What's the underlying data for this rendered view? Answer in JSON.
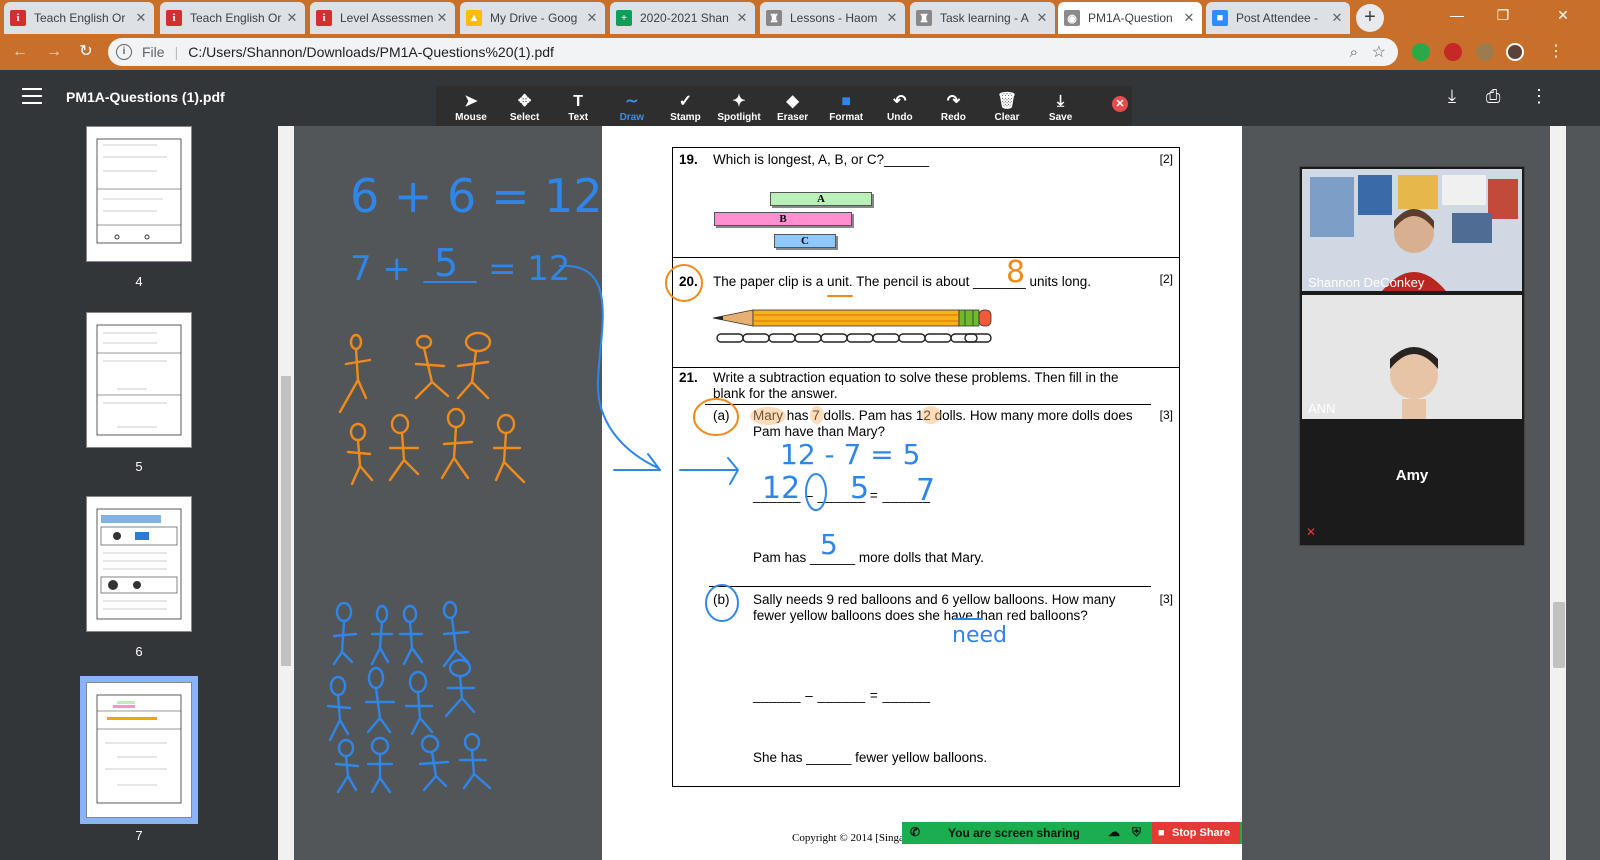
{
  "tabs": [
    {
      "title": "Teach English Or",
      "icon": "i",
      "color": "#d32f2f",
      "active": false
    },
    {
      "title": "Teach English Or",
      "icon": "i",
      "color": "#d32f2f",
      "active": false
    },
    {
      "title": "Level Assessmen",
      "icon": "i",
      "color": "#d32f2f",
      "active": false
    },
    {
      "title": "My Drive - Goog",
      "icon": "▲",
      "color": "#fbbc04",
      "active": false
    },
    {
      "title": "2020-2021 Shan",
      "icon": "+",
      "color": "#0f9d58",
      "active": false
    },
    {
      "title": "Lessons - Haom",
      "icon": "♜",
      "color": "#888888",
      "active": false
    },
    {
      "title": "Task learning - A",
      "icon": "♜",
      "color": "#888888",
      "active": false
    },
    {
      "title": "PM1A-Question",
      "icon": "◉",
      "color": "#8a8a8a",
      "active": true
    },
    {
      "title": "Post Attendee -",
      "icon": "■",
      "color": "#2d8cff",
      "active": false
    }
  ],
  "address": {
    "file_label": "File",
    "url": "C:/Users/Shannon/Downloads/PM1A-Questions%20(1).pdf"
  },
  "pdf": {
    "title": "PM1A-Questions (1).pdf"
  },
  "annotation_tools": [
    {
      "label": "Mouse",
      "icon": "➤"
    },
    {
      "label": "Select",
      "icon": "✥"
    },
    {
      "label": "Text",
      "icon": "T"
    },
    {
      "label": "Draw",
      "icon": "∼",
      "active": true
    },
    {
      "label": "Stamp",
      "icon": "✓"
    },
    {
      "label": "Spotlight",
      "icon": "✦"
    },
    {
      "label": "Eraser",
      "icon": "◆"
    },
    {
      "label": "Format",
      "icon": "■"
    },
    {
      "label": "Undo",
      "icon": "↶"
    },
    {
      "label": "Redo",
      "icon": "↷"
    },
    {
      "label": "Clear",
      "icon": "🗑"
    },
    {
      "label": "Save",
      "icon": "⤓"
    }
  ],
  "thumbnails": [
    {
      "num": "4"
    },
    {
      "num": "5"
    },
    {
      "num": "6"
    },
    {
      "num": "7"
    }
  ],
  "questions": {
    "q19": {
      "num": "19.",
      "text": "Which is longest, A, B, or C?______",
      "points": "[2]",
      "bars": [
        {
          "label": "A",
          "color": "#b8f0b8"
        },
        {
          "label": "B",
          "color": "#ff8fd0"
        },
        {
          "label": "C",
          "color": "#8fc8ff"
        }
      ]
    },
    "q20": {
      "num": "20.",
      "text_before": "The paper clip is a unit. The pencil is about ",
      "blank": "_______",
      "text_after": " units long.",
      "points": "[2]"
    },
    "q21": {
      "num": "21.",
      "text": "Write a subtraction equation to solve these problems. Then fill in the blank for the answer.",
      "a": {
        "label": "(a)",
        "text": "Mary has 7 dolls. Pam has 12 dolls. How many more dolls does Pam have than Mary?",
        "points": "[3]",
        "equation": "______ – ______ = ______",
        "answer_before": "Pam has ",
        "answer_blank": "______",
        "answer_after": " more dolls that Mary."
      },
      "b": {
        "label": "(b)",
        "text": "Sally needs 9 red balloons and 6 yellow balloons. How many fewer yellow balloons does she have than red balloons?",
        "points": "[3]",
        "equation": "______ – ______ = ______",
        "answer_before": "She has ",
        "answer_blank": "______",
        "answer_after": " fewer yellow balloons."
      }
    }
  },
  "copyright": "Copyright © 2014 [Singa",
  "video": {
    "teacher_name": "Shannon DeConkey",
    "student_name": "ANN",
    "third_name": "Amy"
  },
  "screenshare": {
    "status": "You are screen sharing",
    "stop_label": "Stop Share"
  },
  "handwriting": {
    "eq1": "6 + 6 = 12",
    "eq2_a": "7 +",
    "eq2_b": "5",
    "eq2_c": "= 12",
    "pencil_answer": "8",
    "sub_eq": "12 - 7 = 5",
    "blank1": "12",
    "blank2": "5",
    "blank3": "7",
    "answer_a": "5",
    "need": "need"
  }
}
